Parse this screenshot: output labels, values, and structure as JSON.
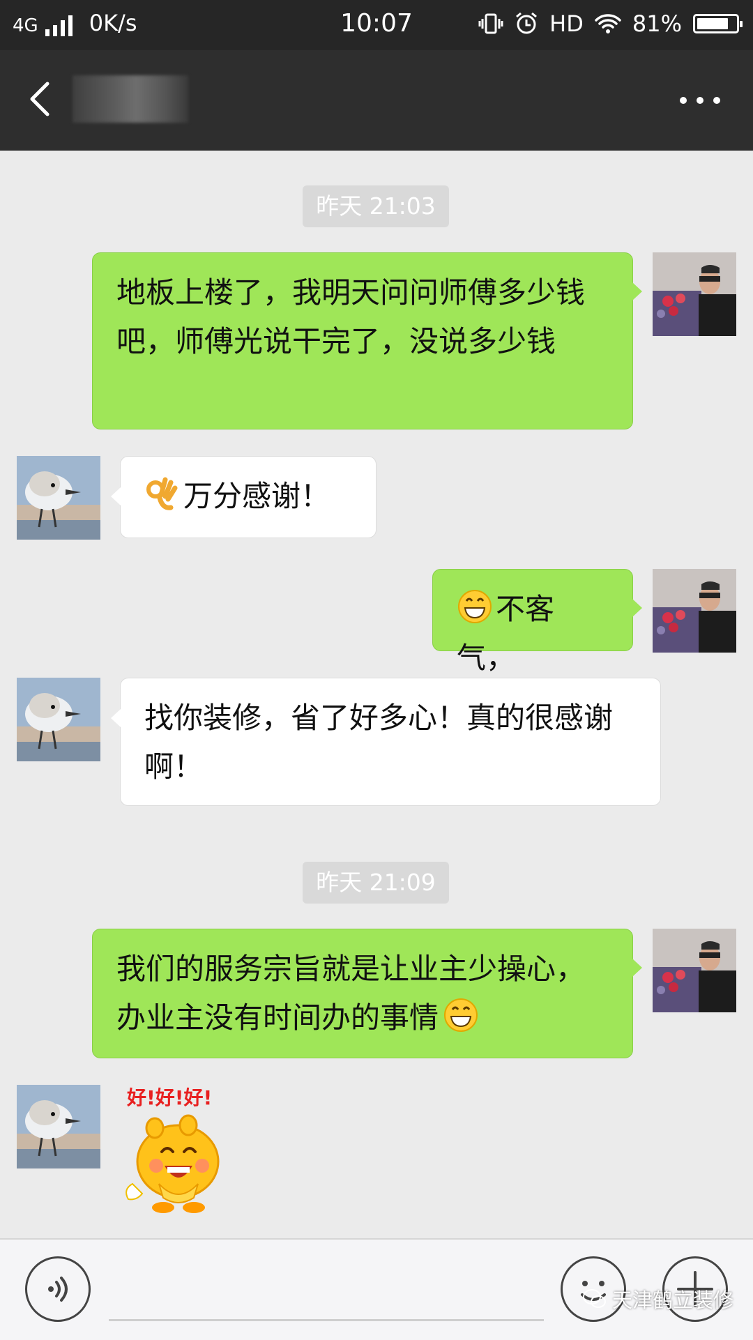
{
  "status_bar": {
    "network": "4G",
    "speed": "0K/s",
    "time": "10:07",
    "hd": "HD",
    "battery": "81%",
    "battery_level": 0.81
  },
  "header": {
    "contact_name": "",
    "back_icon": "chevron-left-icon",
    "more_icon": "more-dots-icon"
  },
  "chat": {
    "timestamp_1": "昨天 21:03",
    "msg_1": "地板上楼了，我明天问问师傅多少钱吧，师傅光说干完了，没说多少钱",
    "msg_2": "万分感谢！",
    "msg_2_emoji": "ok-hand-emoji",
    "msg_3": "不客气，",
    "msg_3_emoji": "grin-emoji",
    "msg_4": "找你装修，省了好多心！真的很感谢啊！",
    "timestamp_2": "昨天 21:09",
    "msg_5": "我们的服务宗旨就是让业主少操心，办业主没有时间办的事情",
    "msg_5_emoji": "grin-emoji",
    "sticker_text": "好!好!好!"
  },
  "input_bar": {
    "voice_icon": "voice-icon",
    "emoji_icon": "emoji-icon",
    "plus_icon": "plus-icon"
  },
  "watermark": "天津鹤立装修"
}
